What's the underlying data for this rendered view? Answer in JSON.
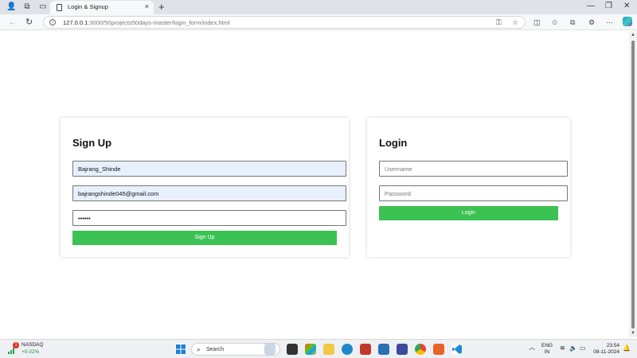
{
  "browser": {
    "tab_title": "Login & Signup",
    "url_host": "127.0.0.1",
    "url_path": ":3000/50projects50days-master/login_form/index.html",
    "new_tab_glyph": "+",
    "tab_close_glyph": "×"
  },
  "signup": {
    "title": "Sign Up",
    "username_value": "Bajrang_Shinde",
    "email_value": "bajrangshinde045@gmail.com",
    "password_value": "••••••",
    "button_label": "Sign Up"
  },
  "login": {
    "title": "Login",
    "username_placeholder": "Username",
    "password_placeholder": "Password",
    "button_label": "Login"
  },
  "taskbar": {
    "ticker_name": "NASDAQ",
    "ticker_change": "+0.02%",
    "notification_count": "1",
    "search_label": "Search",
    "lang_line1": "ENG",
    "lang_line2": "IN",
    "time": "23:54",
    "date": "08-11-2024"
  },
  "colors": {
    "button_green": "#3cc153",
    "autofill_blue": "#e8f0fe"
  }
}
